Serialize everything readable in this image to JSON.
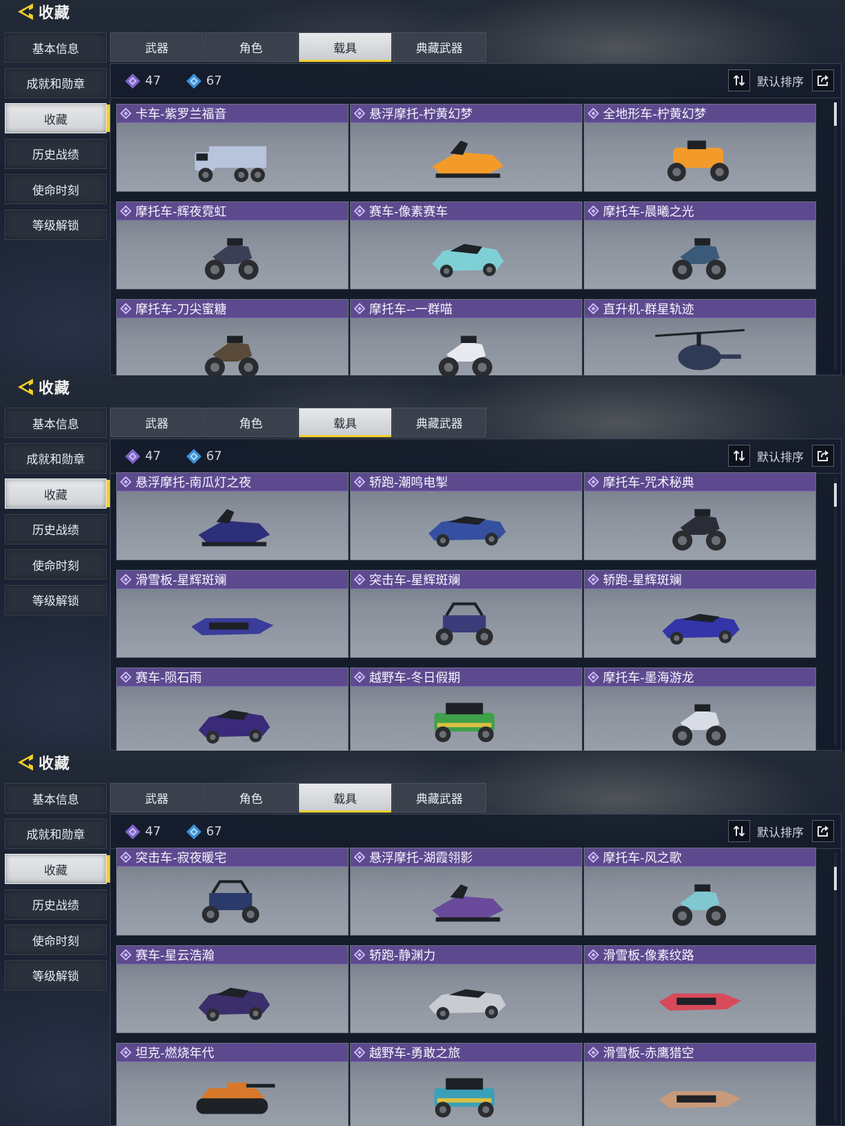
{
  "header": {
    "title": "收藏"
  },
  "side_nav": [
    "基本信息",
    "成就和勋章",
    "收藏",
    "历史战绩",
    "使命时刻",
    "等级解锁"
  ],
  "tabs": [
    "武器",
    "角色",
    "载具",
    "典藏武器"
  ],
  "stats": {
    "purple_count": "47",
    "blue_count": "67"
  },
  "sort_label": "默认排序",
  "colors": {
    "accent_yellow": "#f4cf26",
    "card_header_purple": "#5d4a8e",
    "active_tab": "#e7e8ea"
  },
  "screens": [
    {
      "cards": [
        {
          "name": "卡车-紫罗兰福音",
          "vehicle": "truck",
          "tint": "#b7c4dc"
        },
        {
          "name": "悬浮摩托-柠黄幻梦",
          "vehicle": "hoverbike",
          "tint": "#f39b2a"
        },
        {
          "name": "全地形车-柠黄幻梦",
          "vehicle": "atv",
          "tint": "#f39b2a"
        },
        {
          "name": "摩托车-辉夜霓虹",
          "vehicle": "motorbike",
          "tint": "#3a3f55"
        },
        {
          "name": "赛车-像素赛车",
          "vehicle": "racecar",
          "tint": "#7fd0d6"
        },
        {
          "name": "摩托车-晨曦之光",
          "vehicle": "motorbike",
          "tint": "#3b5a7a"
        },
        {
          "name": "摩托车-刀尖蜜糖",
          "vehicle": "motorbike",
          "tint": "#5a4a3a"
        },
        {
          "name": "摩托车--一群喵",
          "vehicle": "motorbike",
          "tint": "#e8eaf0"
        },
        {
          "name": "直升机-群星轨迹",
          "vehicle": "helicopter",
          "tint": "#2f3a55"
        }
      ]
    },
    {
      "cards": [
        {
          "name": "悬浮摩托-南瓜灯之夜",
          "vehicle": "hoverbike",
          "tint": "#2c2f7a"
        },
        {
          "name": "轿跑-潮鸣电掣",
          "vehicle": "coupe",
          "tint": "#3550a0"
        },
        {
          "name": "摩托车-咒术秘典",
          "vehicle": "motorbike",
          "tint": "#2a2d36"
        },
        {
          "name": "滑雪板-星辉斑斓",
          "vehicle": "snowmobile",
          "tint": "#3a3c9a"
        },
        {
          "name": "突击车-星辉斑斓",
          "vehicle": "buggy",
          "tint": "#3a3c7a"
        },
        {
          "name": "轿跑-星辉斑斓",
          "vehicle": "coupe",
          "tint": "#3335a8"
        },
        {
          "name": "赛车-陨石雨",
          "vehicle": "racecar",
          "tint": "#3a2a7a"
        },
        {
          "name": "越野车-冬日假期",
          "vehicle": "jeep",
          "tint": "#3fa04a"
        },
        {
          "name": "摩托车-墨海游龙",
          "vehicle": "motorbike",
          "tint": "#d8dce4"
        }
      ]
    },
    {
      "cards": [
        {
          "name": "突击车-寂夜暖宅",
          "vehicle": "buggy",
          "tint": "#2a3a6a"
        },
        {
          "name": "悬浮摩托-湖霞翎影",
          "vehicle": "hoverbike",
          "tint": "#6a4a9a"
        },
        {
          "name": "摩托车-风之歌",
          "vehicle": "motorbike",
          "tint": "#7fc8d0"
        },
        {
          "name": "赛车-星云浩瀚",
          "vehicle": "racecar",
          "tint": "#3a2f6a"
        },
        {
          "name": "轿跑-静渊力",
          "vehicle": "coupe",
          "tint": "#c8ccd2"
        },
        {
          "name": "滑雪板-像素纹路",
          "vehicle": "snowmobile",
          "tint": "#d84a5a"
        },
        {
          "name": "坦克-燃烧年代",
          "vehicle": "tank",
          "tint": "#d8782a"
        },
        {
          "name": "越野车-勇敢之旅",
          "vehicle": "jeep",
          "tint": "#3aa0b8"
        },
        {
          "name": "滑雪板-赤鹰猎空",
          "vehicle": "snowmobile",
          "tint": "#c89a7a"
        }
      ]
    }
  ]
}
